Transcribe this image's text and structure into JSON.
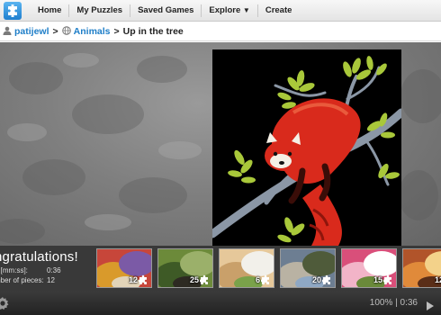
{
  "nav": {
    "items": [
      "Home",
      "My Puzzles",
      "Saved Games",
      "Explore",
      "Create"
    ]
  },
  "breadcrumb": {
    "user": "patijewl",
    "sep1": ">",
    "category": "Animals",
    "sep2": ">",
    "title": "Up in the tree"
  },
  "results": {
    "title": "ngratulations!",
    "time_label": "e [mm:ss]:",
    "time_value": "0:36",
    "pieces_label": "mber of pieces:",
    "pieces_value": "12"
  },
  "thumbnails": [
    {
      "pieces": "12",
      "colors": [
        "#c7463a",
        "#d99a2b",
        "#7b5aa6",
        "#e2d4b8"
      ]
    },
    {
      "pieces": "25",
      "colors": [
        "#6c8a3a",
        "#3e5a26",
        "#9bb06a",
        "#2d2a22"
      ]
    },
    {
      "pieces": "6",
      "colors": [
        "#e6c89a",
        "#c9a06a",
        "#f2f0ea",
        "#7aa24a"
      ]
    },
    {
      "pieces": "20",
      "colors": [
        "#6d7e92",
        "#b9b2a3",
        "#4f5b3a",
        "#8fa8c4"
      ]
    },
    {
      "pieces": "15",
      "colors": [
        "#d94f7a",
        "#f2b4c8",
        "#ffffff",
        "#6a8a3a"
      ]
    },
    {
      "pieces": "12",
      "colors": [
        "#b1542a",
        "#e08a3a",
        "#f3d28a",
        "#5a2e18"
      ]
    }
  ],
  "status": {
    "text": "100% | 0:36"
  },
  "colors": {
    "link": "#1e7ec8",
    "panda": "#d92a1c",
    "leaf": "#a9c83a"
  }
}
